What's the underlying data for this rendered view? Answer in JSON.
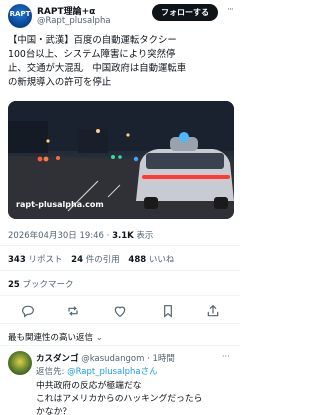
{
  "post": {
    "author_name": "RAPT理論+α",
    "author_handle": "@Rapt_plusalpha",
    "avatar_text": "RAPT",
    "follow_label": "フォローする",
    "more_label": "···",
    "text_lines": [
      "【中国・武漢】百度の自動運転タクシー",
      "100台以上、システム障害により突然停",
      "止、交通が大混乱　中国政府は自動運転車",
      "の新規導入の許可を停止"
    ],
    "media_caption": "rapt-plusalpha.com",
    "timestamp": "2026年04月30日 19:46 · ",
    "views_count": "3.1K",
    "views_label": " 表示"
  },
  "stats": {
    "reposts_count": "343",
    "reposts_label": " リポスト",
    "quotes_count": "24",
    "quotes_label": " 件の引用",
    "likes_count": "488",
    "likes_label": " いいね",
    "bookmarks_count": "25",
    "bookmarks_label": " ブックマーク"
  },
  "actions": [
    "reply-icon",
    "repost-icon",
    "like-icon",
    "bookmark-icon",
    "share-icon"
  ],
  "sort": {
    "label": "最も関連性の高い返信",
    "chevron": "⌄"
  },
  "reply": {
    "name": "カスダンゴ",
    "handle_time": "@kasudangom · 1時間",
    "more_label": "···",
    "to_prefix": "返信先: ",
    "to_handle": "@Rapt_plusalphaさん",
    "lines": [
      "中共政府の反応が極端だな",
      "これはアメリカからのハッキングだったら",
      "かなか？"
    ]
  },
  "colors": {
    "text": "#0f1419",
    "muted": "#536471",
    "link": "#1d9bf0",
    "button": "#0f1419"
  }
}
